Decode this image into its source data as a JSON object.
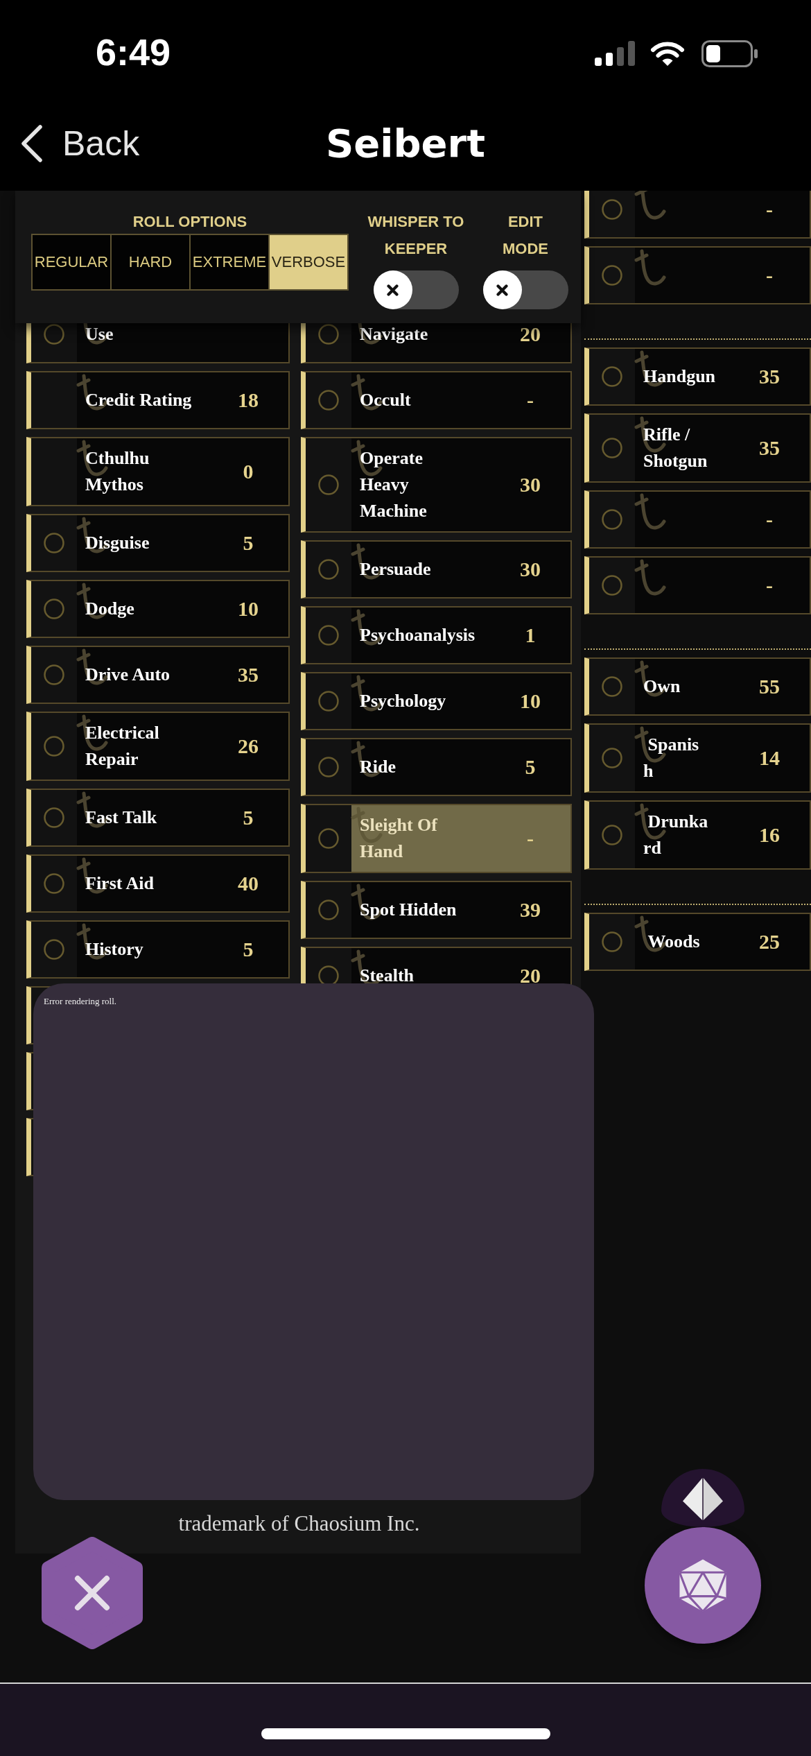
{
  "status_bar": {
    "time": "6:49"
  },
  "nav": {
    "back_label": "Back",
    "title": "Seibert"
  },
  "roll_options": {
    "label": "ROLL OPTIONS",
    "options": [
      {
        "label": "REGULAR",
        "selected": false
      },
      {
        "label": "HARD",
        "selected": false
      },
      {
        "label": "EXTREME",
        "selected": false
      },
      {
        "label": "VERBOSE",
        "selected": true
      }
    ],
    "toggles": [
      {
        "label": "WHISPER TO KEEPER",
        "on": false
      },
      {
        "label": "EDIT MODE",
        "on": false
      }
    ]
  },
  "sheet": {
    "columns": [
      {
        "skills": [
          {
            "kind": "standard",
            "name": "Use",
            "checked": false,
            "selected": false
          },
          {
            "kind": "fixed",
            "name": "Credit Rating",
            "value": "18",
            "selected": false
          },
          {
            "kind": "fixed",
            "name": "Cthulhu Mythos",
            "value": "0",
            "selected": false
          },
          {
            "kind": "standard",
            "name": "Disguise",
            "value": "5",
            "checked": false,
            "selected": false
          },
          {
            "kind": "standard",
            "name": "Dodge",
            "value": "10",
            "checked": false,
            "selected": false
          },
          {
            "kind": "standard",
            "name": "Drive Auto",
            "value": "35",
            "checked": false,
            "selected": false
          },
          {
            "kind": "standard",
            "name": "Electrical Repair",
            "value": "26",
            "checked": false,
            "selected": false
          },
          {
            "kind": "standard",
            "name": "Fast Talk",
            "value": "5",
            "checked": false,
            "selected": false
          },
          {
            "kind": "standard",
            "name": "First Aid",
            "value": "40",
            "checked": false,
            "selected": false
          },
          {
            "kind": "standard",
            "name": "History",
            "value": "5",
            "checked": false,
            "selected": false
          },
          {
            "kind": "fixed"
          },
          {
            "kind": "fixed"
          },
          {
            "kind": "fixed"
          }
        ]
      },
      {
        "skills": [
          {
            "kind": "standard",
            "name": "Navigate",
            "value": "20",
            "checked": false,
            "selected": false
          },
          {
            "kind": "standard",
            "name": "Occult",
            "value": "-",
            "checked": false,
            "selected": false
          },
          {
            "kind": "standard",
            "name": "Operate Heavy Machine",
            "value": "30",
            "checked": false,
            "selected": false
          },
          {
            "kind": "standard",
            "name": "Persuade",
            "value": "30",
            "checked": false,
            "selected": false
          },
          {
            "kind": "standard",
            "name": "Psychoanalysis",
            "value": "1",
            "checked": false,
            "selected": false
          },
          {
            "kind": "standard",
            "name": "Psychology",
            "value": "10",
            "checked": false,
            "selected": false
          },
          {
            "kind": "standard",
            "name": "Ride",
            "value": "5",
            "checked": false,
            "selected": false
          },
          {
            "kind": "standard",
            "name": "Sleight Of Hand",
            "value": "-",
            "checked": false,
            "selected": true
          },
          {
            "kind": "standard",
            "name": "Spot Hidden",
            "value": "39",
            "checked": false,
            "selected": false
          },
          {
            "kind": "standard",
            "name": "Stealth",
            "value": "20",
            "checked": false,
            "selected": false
          }
        ]
      }
    ],
    "footer": "trademark of Chaosium Inc."
  },
  "side_column": {
    "groups": [
      {
        "skills": [
          {
            "kind": "standard",
            "value": "-",
            "checked": false,
            "selected": false
          },
          {
            "kind": "standard",
            "value": "-",
            "checked": false,
            "selected": false
          }
        ]
      },
      {
        "skills": [
          {
            "kind": "standard",
            "name": "Handgun",
            "value": "35",
            "checked": false,
            "selected": false
          },
          {
            "kind": "standard",
            "name": "Rifle / Shotgun",
            "value": "35",
            "checked": false,
            "selected": false
          },
          {
            "kind": "standard",
            "value": "-",
            "checked": false,
            "selected": false
          },
          {
            "kind": "standard",
            "value": "-",
            "checked": false,
            "selected": false
          }
        ]
      },
      {
        "skills": [
          {
            "kind": "standard",
            "name": "Own",
            "value": "55",
            "checked": false,
            "selected": false
          },
          {
            "kind": "custom",
            "name": "Spanish",
            "value": "14",
            "checked": false,
            "selected": false
          },
          {
            "kind": "custom",
            "name": "Drunkard",
            "value": "16",
            "checked": false,
            "selected": false
          }
        ]
      },
      {
        "skills": [
          {
            "kind": "custom",
            "name": "Woods",
            "value": "25",
            "checked": false,
            "selected": false
          }
        ]
      }
    ]
  },
  "error_popup": {
    "message": "Error rendering roll."
  }
}
